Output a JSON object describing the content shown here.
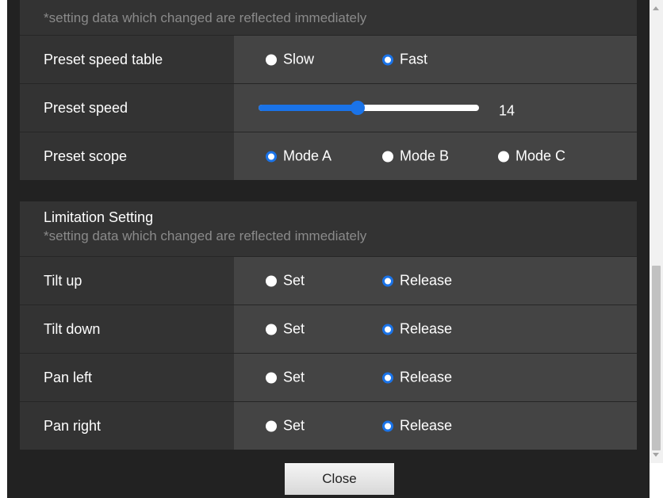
{
  "section1": {
    "note": "*setting data which changed are reflected immediately",
    "rows": [
      {
        "label": "Preset speed table",
        "options": [
          "Slow",
          "Fast"
        ],
        "selected": 1
      },
      {
        "label": "Preset speed",
        "slider_value": "14",
        "slider_fraction": 0.45
      },
      {
        "label": "Preset scope",
        "options": [
          "Mode A",
          "Mode B",
          "Mode C"
        ],
        "selected": 0
      }
    ]
  },
  "section2": {
    "title": "Limitation Setting",
    "note": "*setting data which changed are reflected immediately",
    "rows": [
      {
        "label": "Tilt up",
        "options": [
          "Set",
          "Release"
        ],
        "selected": 1
      },
      {
        "label": "Tilt down",
        "options": [
          "Set",
          "Release"
        ],
        "selected": 1
      },
      {
        "label": "Pan left",
        "options": [
          "Set",
          "Release"
        ],
        "selected": 1
      },
      {
        "label": "Pan right",
        "options": [
          "Set",
          "Release"
        ],
        "selected": 1
      }
    ]
  },
  "footer": {
    "close_label": "Close"
  },
  "colors": {
    "accent": "#1a73e8",
    "label_bg": "#333333",
    "value_bg": "#444444",
    "dialog_bg": "#222222"
  }
}
